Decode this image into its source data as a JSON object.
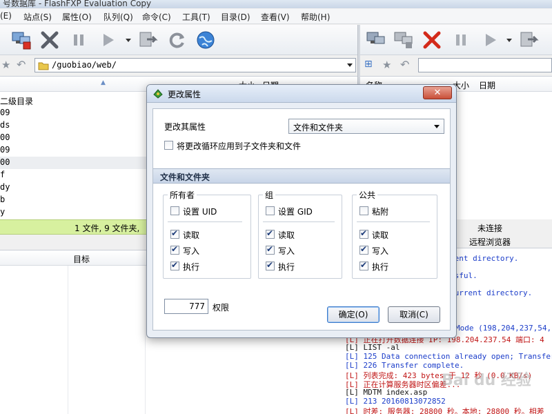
{
  "app": {
    "title": "号数据库 - FlashFXP Evaluation Copy"
  },
  "menu": [
    "(E)",
    "站点(S)",
    "属性(O)",
    "队列(Q)",
    "命令(C)",
    "工具(T)",
    "目录(D)",
    "查看(V)",
    "帮助(H)"
  ],
  "toolbar_icons": [
    "connect-icon",
    "disconnect-icon",
    "abort-icon",
    "pause-icon",
    "play-icon",
    "transfer-icon",
    "refresh-icon",
    "globe-icon"
  ],
  "local": {
    "path": "/guobiao/web/",
    "columns": {
      "size": "大小",
      "date": "日期"
    },
    "rows": [
      "二级目录",
      "09",
      "ds",
      "00",
      "09",
      "00",
      "f",
      "dy",
      "b",
      "y"
    ],
    "status": "1 文件, 9 文件夹,"
  },
  "remote": {
    "columns": {
      "name": "名称",
      "size": "大小",
      "date": "日期"
    },
    "status_line1": "未连接",
    "status_line2": "远程浏览器"
  },
  "queue": {
    "target_label": "目标"
  },
  "log": [
    {
      "text": "rent directory.",
      "color": "blue"
    },
    {
      "text": "ssful.",
      "color": "blue"
    },
    {
      "text": "current directory.",
      "color": "blue"
    },
    {
      "text": "Mode (198,204,237,54,1",
      "color": "blue"
    },
    {
      "text": "[L] 正在打开数据连接 IP: 198.204.237.54 端口: 4",
      "color": "red"
    },
    {
      "text": "[L] LIST -al",
      "color": "dark"
    },
    {
      "text": "[L] 125 Data connection already open; Transfer",
      "color": "blue"
    },
    {
      "text": "[L] 226 Transfer complete.",
      "color": "blue"
    },
    {
      "text": "[L] 列表完成: 423 bytes 于 12 秒 (0.0 KB/s)",
      "color": "red"
    },
    {
      "text": "[L] 正在计算服务器时区偏差...",
      "color": "red"
    },
    {
      "text": "[L] MDTM index.asp",
      "color": "dark"
    },
    {
      "text": "[L] 213 20160813072852",
      "color": "blue"
    },
    {
      "text": "[L] 时差: 服务器: 28800 秒。本地: 28800 秒。相差",
      "color": "red"
    }
  ],
  "dialog": {
    "title": "更改属性",
    "change_label": "更改其属性",
    "target_value": "文件和文件夹",
    "recursive_label": "将更改循环应用到子文件夹和文件",
    "section_title": "文件和文件夹",
    "groups": [
      {
        "title": "所有者",
        "special": "设置 UID",
        "special_checked": false
      },
      {
        "title": "组",
        "special": "设置 GID",
        "special_checked": false
      },
      {
        "title": "公共",
        "special": "粘附",
        "special_checked": false
      }
    ],
    "perm_labels": {
      "read": "读取",
      "write": "写入",
      "exec": "执行"
    },
    "permission_value": "777",
    "permission_label": "权限",
    "ok_label": "确定(O)",
    "cancel_label": "取消(C)"
  },
  "watermark": "Bai du 经验"
}
